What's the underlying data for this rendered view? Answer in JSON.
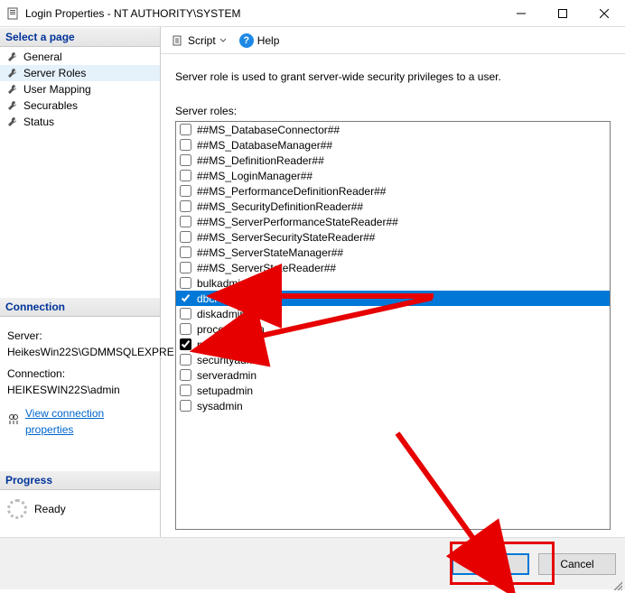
{
  "window": {
    "title": "Login Properties - NT AUTHORITY\\SYSTEM"
  },
  "sidebar": {
    "select_page_header": "Select a page",
    "items": [
      {
        "label": "General"
      },
      {
        "label": "Server Roles"
      },
      {
        "label": "User Mapping"
      },
      {
        "label": "Securables"
      },
      {
        "label": "Status"
      }
    ],
    "connection": {
      "header": "Connection",
      "server_label": "Server:",
      "server_value": "HeikesWin22S\\GDMMSQLEXPRE",
      "conn_label": "Connection:",
      "conn_value": "HEIKESWIN22S\\admin",
      "view_props": "View connection properties"
    },
    "progress": {
      "header": "Progress",
      "status": "Ready"
    }
  },
  "toolbar": {
    "script": "Script",
    "help": "Help"
  },
  "main": {
    "description": "Server role is used to grant server-wide security privileges to a user.",
    "roles_label": "Server roles:",
    "roles": [
      {
        "name": "##MS_DatabaseConnector##",
        "checked": false,
        "selected": false
      },
      {
        "name": "##MS_DatabaseManager##",
        "checked": false,
        "selected": false
      },
      {
        "name": "##MS_DefinitionReader##",
        "checked": false,
        "selected": false
      },
      {
        "name": "##MS_LoginManager##",
        "checked": false,
        "selected": false
      },
      {
        "name": "##MS_PerformanceDefinitionReader##",
        "checked": false,
        "selected": false
      },
      {
        "name": "##MS_SecurityDefinitionReader##",
        "checked": false,
        "selected": false
      },
      {
        "name": "##MS_ServerPerformanceStateReader##",
        "checked": false,
        "selected": false
      },
      {
        "name": "##MS_ServerSecurityStateReader##",
        "checked": false,
        "selected": false
      },
      {
        "name": "##MS_ServerStateManager##",
        "checked": false,
        "selected": false
      },
      {
        "name": "##MS_ServerStateReader##",
        "checked": false,
        "selected": false
      },
      {
        "name": "bulkadmin",
        "checked": false,
        "selected": false
      },
      {
        "name": "dbcreator",
        "checked": true,
        "selected": true
      },
      {
        "name": "diskadmin",
        "checked": false,
        "selected": false
      },
      {
        "name": "processadmin",
        "checked": false,
        "selected": false
      },
      {
        "name": "public",
        "checked": true,
        "selected": false
      },
      {
        "name": "securityadmin",
        "checked": false,
        "selected": false
      },
      {
        "name": "serveradmin",
        "checked": false,
        "selected": false
      },
      {
        "name": "setupadmin",
        "checked": false,
        "selected": false
      },
      {
        "name": "sysadmin",
        "checked": false,
        "selected": false
      }
    ]
  },
  "footer": {
    "ok": "OK",
    "cancel": "Cancel"
  },
  "annotations": {
    "highlight_color": "#e60000"
  }
}
